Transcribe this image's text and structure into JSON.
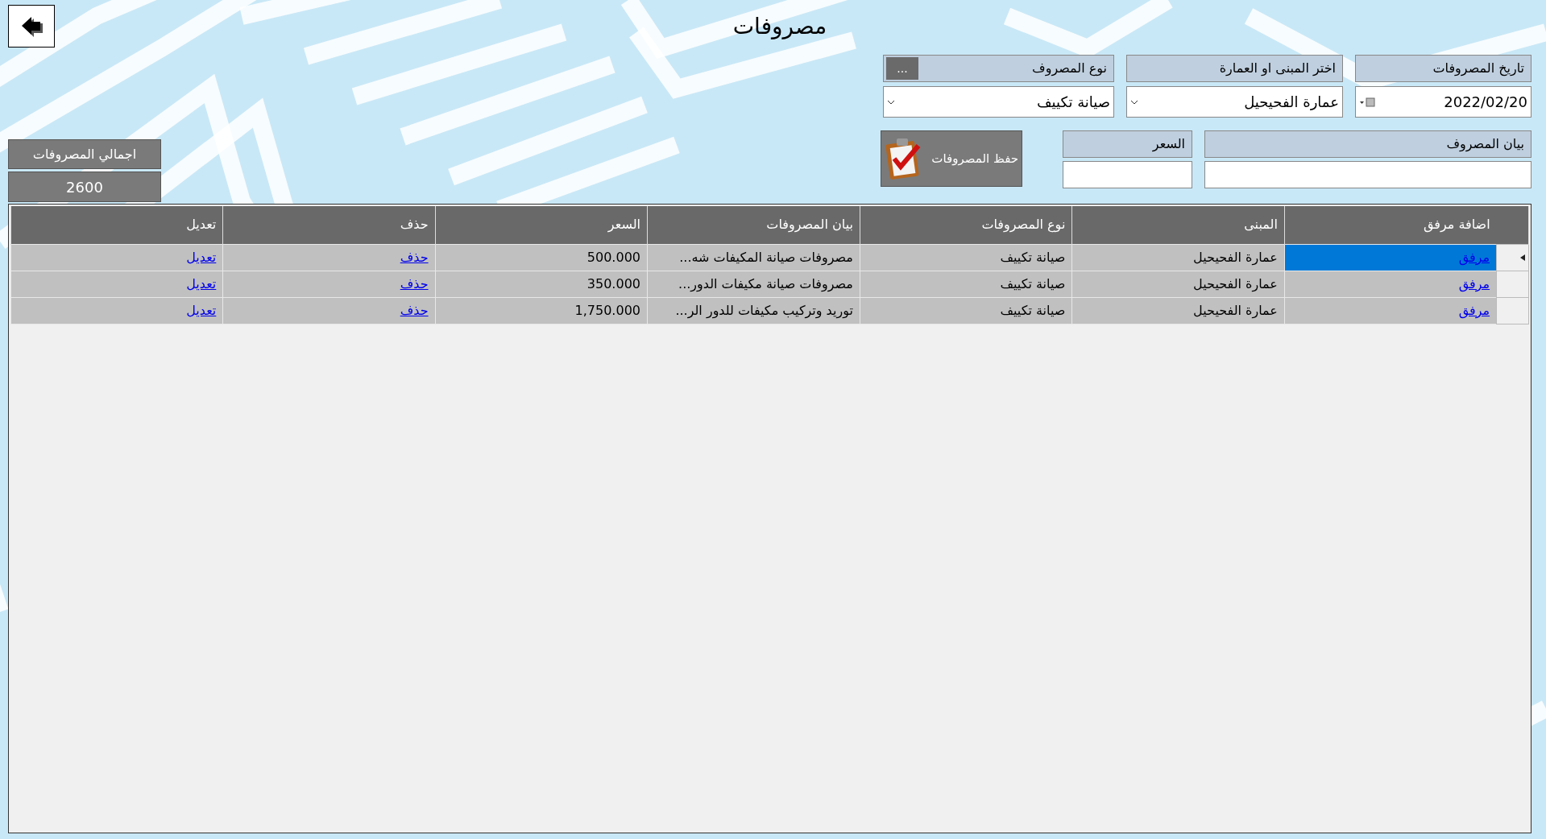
{
  "title": "مصروفات",
  "filters": [
    {
      "kind": "date",
      "label": "تاريخ المصروفات",
      "value": "2022/02/20"
    },
    {
      "kind": "dropdown",
      "label": "اختر المبنى او العمارة",
      "value": "عمارة الفحيحيل"
    },
    {
      "kind": "dropdown",
      "label": "نوع المصروف",
      "value": "صيانة تكييف",
      "button": "..."
    }
  ],
  "entry": {
    "description_label": "بيان المصروف",
    "price_label": "السعر",
    "save_button": "حفظ المصروفات"
  },
  "total": {
    "label": "اجمالي المصروفات",
    "value": "2600"
  },
  "table": {
    "columns": [
      {
        "label": "اضافة مرفق",
        "kind": "link"
      },
      {
        "label": "المبنى",
        "kind": "text"
      },
      {
        "label": "نوع المصروفات",
        "kind": "text"
      },
      {
        "label": "بيان المصروفات",
        "kind": "text"
      },
      {
        "label": "السعر",
        "kind": "text"
      },
      {
        "label": "حذف",
        "kind": "link"
      },
      {
        "label": "تعديل",
        "kind": "link"
      }
    ],
    "rows": [
      {
        "selected": true,
        "cells": [
          "مرفق",
          "عمارة الفحيحيل",
          "صيانة تكييف",
          "مصروفات صيانة المكيفات شه...",
          "500.000",
          "حذف",
          "تعديل"
        ]
      },
      {
        "selected": false,
        "cells": [
          "مرفق",
          "عمارة الفحيحيل",
          "صيانة تكييف",
          "مصروفات صيانة مكيفات الدور...",
          "350.000",
          "حذف",
          "تعديل"
        ]
      },
      {
        "selected": false,
        "cells": [
          "مرفق",
          "عمارة الفحيحيل",
          "صيانة تكييف",
          "توريد وتركيب مكيفات للدور الر...",
          "1,750.000",
          "حذف",
          "تعديل"
        ]
      }
    ]
  }
}
